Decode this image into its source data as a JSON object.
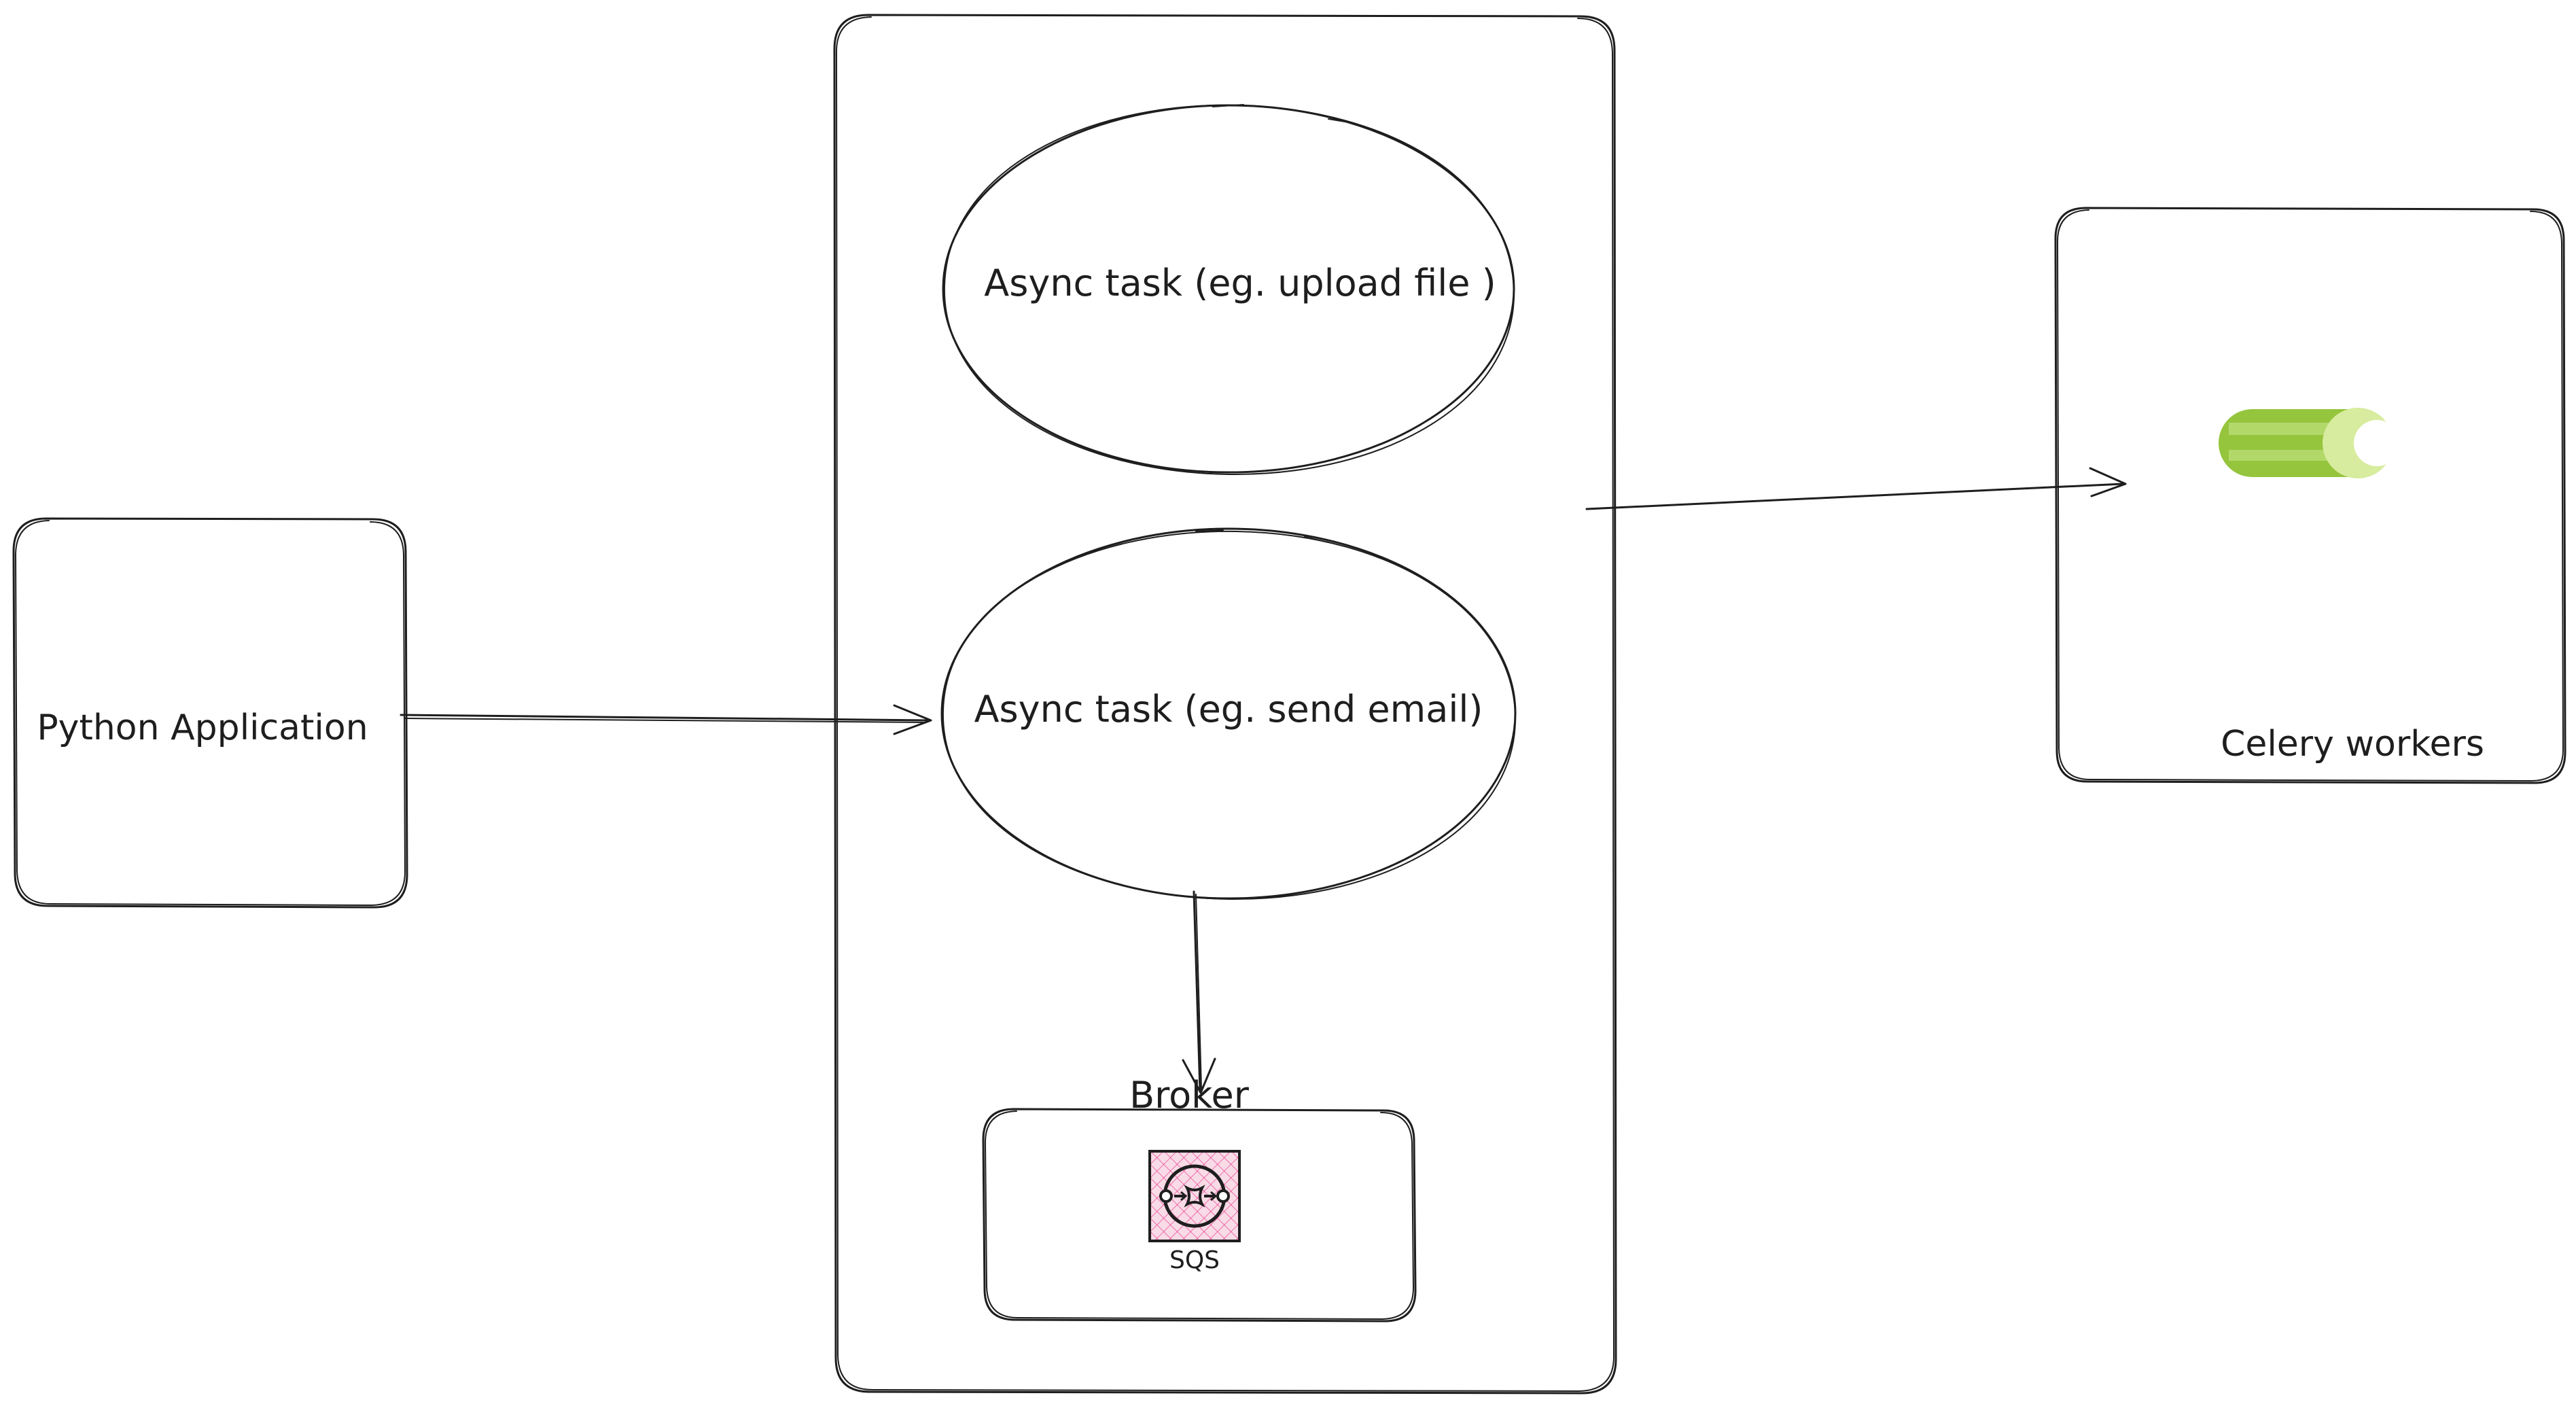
{
  "diagram": {
    "python_app": {
      "label": "Python Application"
    },
    "task_queue": {
      "task_upload": {
        "label": "Async task (eg. upload file )"
      },
      "task_email": {
        "label": "Async task (eg. send email)"
      }
    },
    "broker": {
      "title": "Broker",
      "service": {
        "label": "SQS",
        "icon": "sqs-icon",
        "color": "#e7157b"
      }
    },
    "celery": {
      "label": "Celery workers",
      "icon": "celery-logo-icon",
      "color": "#a0c850"
    },
    "edges": [
      {
        "from": "python_app",
        "to": "task_email"
      },
      {
        "from": "task_queue",
        "to": "celery"
      },
      {
        "from": "task_email",
        "to": "broker"
      }
    ]
  }
}
